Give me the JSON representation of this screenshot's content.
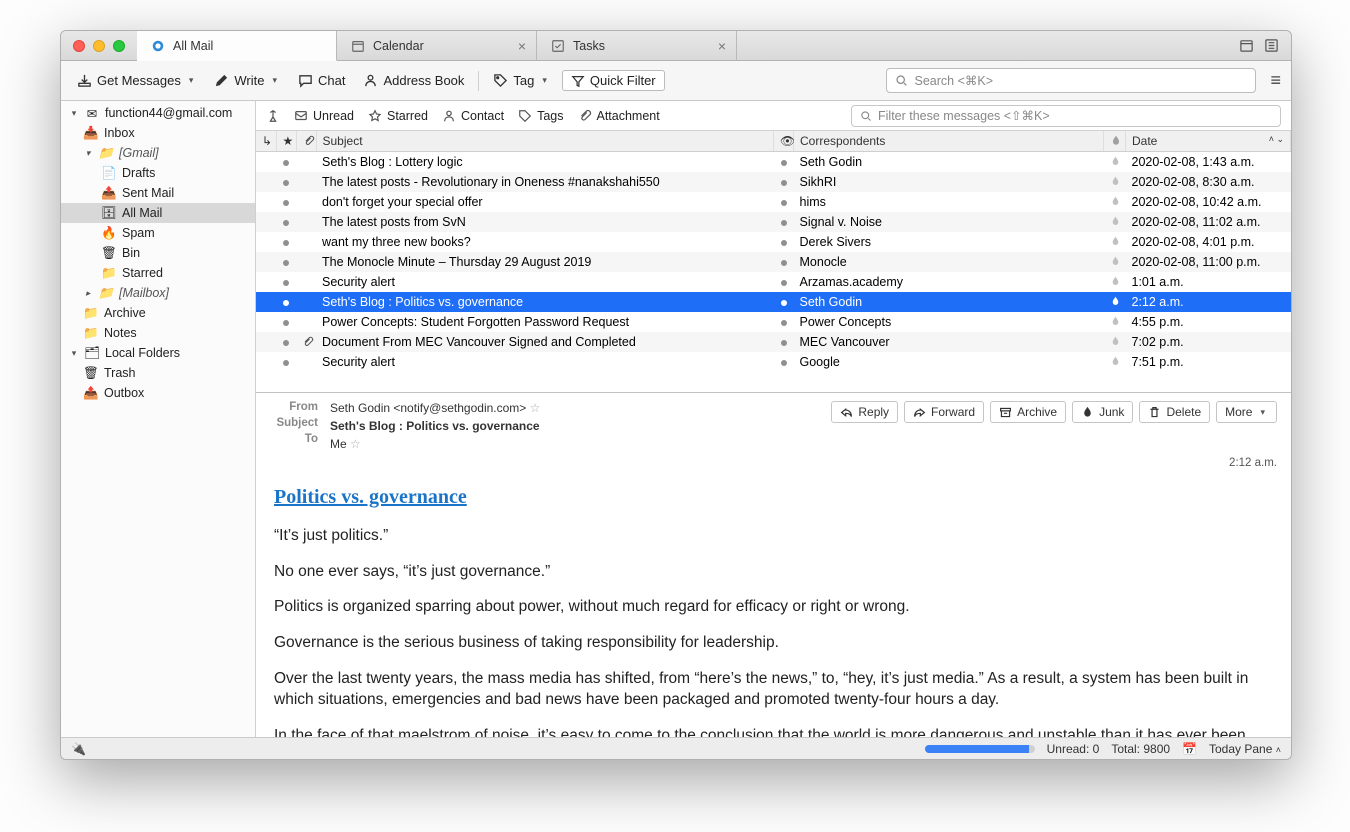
{
  "tabs": [
    {
      "label": "All Mail",
      "active": true,
      "closable": false
    },
    {
      "label": "Calendar",
      "active": false,
      "closable": true
    },
    {
      "label": "Tasks",
      "active": false,
      "closable": true
    }
  ],
  "toolbar": {
    "get_messages": "Get Messages",
    "write": "Write",
    "chat": "Chat",
    "address_book": "Address Book",
    "tag": "Tag",
    "quick_filter": "Quick Filter",
    "search_placeholder": "Search <⌘K>"
  },
  "filterbar": {
    "unread": "Unread",
    "starred": "Starred",
    "contact": "Contact",
    "tags": "Tags",
    "attachment": "Attachment",
    "filter_placeholder": "Filter these messages <⇧⌘K>"
  },
  "columns": {
    "subject": "Subject",
    "correspondents": "Correspondents",
    "date": "Date"
  },
  "folders": {
    "account": "function44@gmail.com",
    "inbox": "Inbox",
    "gmail": "[Gmail]",
    "drafts": "Drafts",
    "sent": "Sent Mail",
    "all_mail": "All Mail",
    "spam": "Spam",
    "bin": "Bin",
    "starred": "Starred",
    "mailbox": "[Mailbox]",
    "archive": "Archive",
    "notes": "Notes",
    "local": "Local Folders",
    "trash": "Trash",
    "outbox": "Outbox"
  },
  "messages": [
    {
      "subject": "Seth's Blog : Lottery logic",
      "from": "Seth Godin",
      "date": "2020-02-08, 1:43 a.m.",
      "att": false,
      "sel": false
    },
    {
      "subject": "The latest posts - Revolutionary in Oneness #nanakshahi550",
      "from": "SikhRI",
      "date": "2020-02-08, 8:30 a.m.",
      "att": false,
      "sel": false
    },
    {
      "subject": "don't forget your special offer",
      "from": "hims",
      "date": "2020-02-08, 10:42 a.m.",
      "att": false,
      "sel": false
    },
    {
      "subject": "The latest posts from SvN",
      "from": "Signal v. Noise",
      "date": "2020-02-08, 11:02 a.m.",
      "att": false,
      "sel": false
    },
    {
      "subject": "want my three new books?",
      "from": "Derek Sivers",
      "date": "2020-02-08, 4:01 p.m.",
      "att": false,
      "sel": false
    },
    {
      "subject": "The Monocle Minute – Thursday 29 August 2019",
      "from": "Monocle",
      "date": "2020-02-08, 11:00 p.m.",
      "att": false,
      "sel": false
    },
    {
      "subject": "Security alert",
      "from": "Arzamas.academy",
      "date": "1:01 a.m.",
      "att": false,
      "sel": false
    },
    {
      "subject": "Seth's Blog : Politics vs. governance",
      "from": "Seth Godin",
      "date": "2:12 a.m.",
      "att": false,
      "sel": true
    },
    {
      "subject": "Power Concepts: Student Forgotten Password Request",
      "from": "Power Concepts",
      "date": "4:55 p.m.",
      "att": false,
      "sel": false
    },
    {
      "subject": "Document From MEC Vancouver Signed and Completed",
      "from": "MEC Vancouver",
      "date": "7:02 p.m.",
      "att": true,
      "sel": false
    },
    {
      "subject": "Security alert",
      "from": "Google",
      "date": "7:51 p.m.",
      "att": false,
      "sel": false
    }
  ],
  "preview": {
    "labels": {
      "from": "From",
      "subject": "Subject",
      "to": "To"
    },
    "from": "Seth Godin <notify@sethgodin.com>",
    "subject": "Seth's Blog : Politics vs. governance",
    "to": "Me",
    "time": "2:12 a.m.",
    "actions": {
      "reply": "Reply",
      "forward": "Forward",
      "archive": "Archive",
      "junk": "Junk",
      "delete": "Delete",
      "more": "More"
    },
    "title": "Politics vs. governance",
    "paragraphs": [
      "“It’s just politics.”",
      "No one ever says, “it’s just governance.”",
      "Politics is organized sparring about power, without much regard for efficacy or right or wrong.",
      "Governance is the serious business of taking responsibility for leadership.",
      "Over the last twenty years, the mass media has shifted, from “here’s the news,” to, “hey, it’s just media.” As a result, a system has been built in which situations, emergencies and bad news have been packaged and promoted twenty-four hours a day.",
      "In the face of that maelstrom of noise, it’s easy to come to the conclusion that the world is more dangerous and unstable than it has ever been."
    ]
  },
  "status": {
    "unread": "Unread: 0",
    "total": "Total: 9800",
    "today_pane": "Today Pane"
  }
}
